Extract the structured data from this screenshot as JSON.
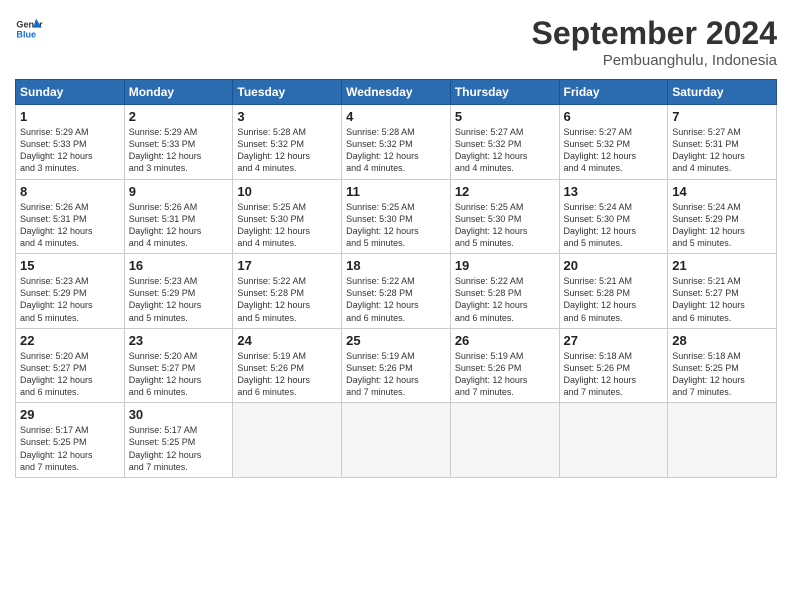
{
  "header": {
    "logo_line1": "General",
    "logo_line2": "Blue",
    "month": "September 2024",
    "location": "Pembuanghulu, Indonesia"
  },
  "days_of_week": [
    "Sunday",
    "Monday",
    "Tuesday",
    "Wednesday",
    "Thursday",
    "Friday",
    "Saturday"
  ],
  "weeks": [
    [
      {
        "day": "1",
        "info": "Sunrise: 5:29 AM\nSunset: 5:33 PM\nDaylight: 12 hours\nand 3 minutes."
      },
      {
        "day": "2",
        "info": "Sunrise: 5:29 AM\nSunset: 5:33 PM\nDaylight: 12 hours\nand 3 minutes."
      },
      {
        "day": "3",
        "info": "Sunrise: 5:28 AM\nSunset: 5:32 PM\nDaylight: 12 hours\nand 4 minutes."
      },
      {
        "day": "4",
        "info": "Sunrise: 5:28 AM\nSunset: 5:32 PM\nDaylight: 12 hours\nand 4 minutes."
      },
      {
        "day": "5",
        "info": "Sunrise: 5:27 AM\nSunset: 5:32 PM\nDaylight: 12 hours\nand 4 minutes."
      },
      {
        "day": "6",
        "info": "Sunrise: 5:27 AM\nSunset: 5:32 PM\nDaylight: 12 hours\nand 4 minutes."
      },
      {
        "day": "7",
        "info": "Sunrise: 5:27 AM\nSunset: 5:31 PM\nDaylight: 12 hours\nand 4 minutes."
      }
    ],
    [
      {
        "day": "8",
        "info": "Sunrise: 5:26 AM\nSunset: 5:31 PM\nDaylight: 12 hours\nand 4 minutes."
      },
      {
        "day": "9",
        "info": "Sunrise: 5:26 AM\nSunset: 5:31 PM\nDaylight: 12 hours\nand 4 minutes."
      },
      {
        "day": "10",
        "info": "Sunrise: 5:25 AM\nSunset: 5:30 PM\nDaylight: 12 hours\nand 4 minutes."
      },
      {
        "day": "11",
        "info": "Sunrise: 5:25 AM\nSunset: 5:30 PM\nDaylight: 12 hours\nand 5 minutes."
      },
      {
        "day": "12",
        "info": "Sunrise: 5:25 AM\nSunset: 5:30 PM\nDaylight: 12 hours\nand 5 minutes."
      },
      {
        "day": "13",
        "info": "Sunrise: 5:24 AM\nSunset: 5:30 PM\nDaylight: 12 hours\nand 5 minutes."
      },
      {
        "day": "14",
        "info": "Sunrise: 5:24 AM\nSunset: 5:29 PM\nDaylight: 12 hours\nand 5 minutes."
      }
    ],
    [
      {
        "day": "15",
        "info": "Sunrise: 5:23 AM\nSunset: 5:29 PM\nDaylight: 12 hours\nand 5 minutes."
      },
      {
        "day": "16",
        "info": "Sunrise: 5:23 AM\nSunset: 5:29 PM\nDaylight: 12 hours\nand 5 minutes."
      },
      {
        "day": "17",
        "info": "Sunrise: 5:22 AM\nSunset: 5:28 PM\nDaylight: 12 hours\nand 5 minutes."
      },
      {
        "day": "18",
        "info": "Sunrise: 5:22 AM\nSunset: 5:28 PM\nDaylight: 12 hours\nand 6 minutes."
      },
      {
        "day": "19",
        "info": "Sunrise: 5:22 AM\nSunset: 5:28 PM\nDaylight: 12 hours\nand 6 minutes."
      },
      {
        "day": "20",
        "info": "Sunrise: 5:21 AM\nSunset: 5:28 PM\nDaylight: 12 hours\nand 6 minutes."
      },
      {
        "day": "21",
        "info": "Sunrise: 5:21 AM\nSunset: 5:27 PM\nDaylight: 12 hours\nand 6 minutes."
      }
    ],
    [
      {
        "day": "22",
        "info": "Sunrise: 5:20 AM\nSunset: 5:27 PM\nDaylight: 12 hours\nand 6 minutes."
      },
      {
        "day": "23",
        "info": "Sunrise: 5:20 AM\nSunset: 5:27 PM\nDaylight: 12 hours\nand 6 minutes."
      },
      {
        "day": "24",
        "info": "Sunrise: 5:19 AM\nSunset: 5:26 PM\nDaylight: 12 hours\nand 6 minutes."
      },
      {
        "day": "25",
        "info": "Sunrise: 5:19 AM\nSunset: 5:26 PM\nDaylight: 12 hours\nand 7 minutes."
      },
      {
        "day": "26",
        "info": "Sunrise: 5:19 AM\nSunset: 5:26 PM\nDaylight: 12 hours\nand 7 minutes."
      },
      {
        "day": "27",
        "info": "Sunrise: 5:18 AM\nSunset: 5:26 PM\nDaylight: 12 hours\nand 7 minutes."
      },
      {
        "day": "28",
        "info": "Sunrise: 5:18 AM\nSunset: 5:25 PM\nDaylight: 12 hours\nand 7 minutes."
      }
    ],
    [
      {
        "day": "29",
        "info": "Sunrise: 5:17 AM\nSunset: 5:25 PM\nDaylight: 12 hours\nand 7 minutes."
      },
      {
        "day": "30",
        "info": "Sunrise: 5:17 AM\nSunset: 5:25 PM\nDaylight: 12 hours\nand 7 minutes."
      },
      {
        "day": "",
        "info": ""
      },
      {
        "day": "",
        "info": ""
      },
      {
        "day": "",
        "info": ""
      },
      {
        "day": "",
        "info": ""
      },
      {
        "day": "",
        "info": ""
      }
    ]
  ]
}
